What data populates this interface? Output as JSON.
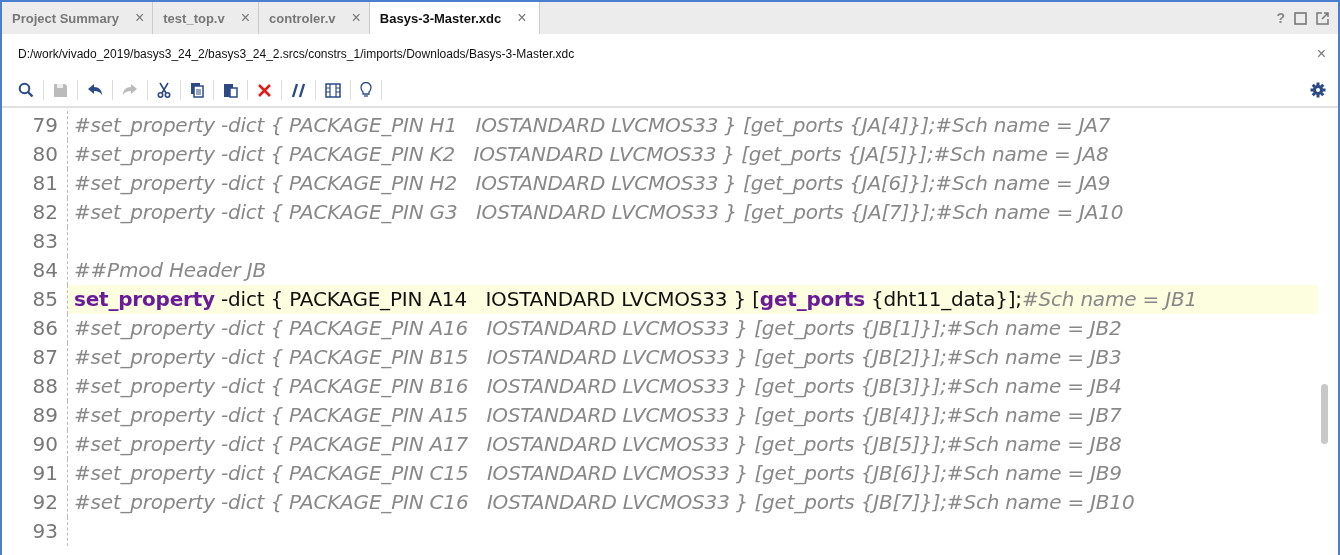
{
  "tabs": [
    {
      "label": "Project Summary",
      "selected": false,
      "close": "×"
    },
    {
      "label": "test_top.v",
      "selected": false,
      "close": "×"
    },
    {
      "label": "controler.v",
      "selected": false,
      "close": "×"
    },
    {
      "label": "Basys-3-Master.xdc",
      "selected": true,
      "close": "×"
    }
  ],
  "tab_bar_actions": [
    {
      "kind": "help",
      "label": "?"
    },
    {
      "kind": "maximize"
    },
    {
      "kind": "float"
    }
  ],
  "file_path": "D:/work/vivado_2019/basys3_24_2/basys3_24_2.srcs/constrs_1/imports/Downloads/Basys-3-Master.xdc",
  "path_close": "×",
  "toolbar": [
    {
      "kind": "search",
      "disabled": false
    },
    {
      "kind": "save",
      "disabled": true
    },
    {
      "kind": "undo",
      "disabled": false
    },
    {
      "kind": "redo",
      "disabled": true
    },
    {
      "kind": "cut",
      "disabled": false
    },
    {
      "kind": "copy",
      "disabled": false
    },
    {
      "kind": "paste",
      "disabled": false
    },
    {
      "kind": "delete",
      "disabled": false
    },
    {
      "kind": "comment",
      "disabled": false
    },
    {
      "kind": "columns",
      "disabled": false
    },
    {
      "kind": "bulb",
      "disabled": false
    }
  ],
  "lines": [
    {
      "number": "79",
      "current": false,
      "segments": [
        {
          "kind": "comment",
          "text": "#set_property -dict { PACKAGE_PIN H1   IOSTANDARD LVCMOS33 } [get_ports {JA[4]}];#Sch name = JA7"
        }
      ]
    },
    {
      "number": "80",
      "current": false,
      "segments": [
        {
          "kind": "comment",
          "text": "#set_property -dict { PACKAGE_PIN K2   IOSTANDARD LVCMOS33 } [get_ports {JA[5]}];#Sch name = JA8"
        }
      ]
    },
    {
      "number": "81",
      "current": false,
      "segments": [
        {
          "kind": "comment",
          "text": "#set_property -dict { PACKAGE_PIN H2   IOSTANDARD LVCMOS33 } [get_ports {JA[6]}];#Sch name = JA9"
        }
      ]
    },
    {
      "number": "82",
      "current": false,
      "segments": [
        {
          "kind": "comment",
          "text": "#set_property -dict { PACKAGE_PIN G3   IOSTANDARD LVCMOS33 } [get_ports {JA[7]}];#Sch name = JA10"
        }
      ]
    },
    {
      "number": "83",
      "current": false
    },
    {
      "number": "84",
      "current": false,
      "segments": [
        {
          "kind": "comment",
          "text": "##Pmod Header JB"
        }
      ]
    },
    {
      "number": "85",
      "current": true,
      "segments": [
        {
          "kind": "keyword",
          "text": "set_property"
        },
        {
          "kind": "plain",
          "text": " -dict { PACKAGE_PIN A14   IOSTANDARD LVCMOS33 } ["
        },
        {
          "kind": "keyword",
          "text": "get_ports"
        },
        {
          "kind": "plain",
          "text": " {dht11_data}];"
        },
        {
          "kind": "comment",
          "text": "#Sch name = JB1"
        }
      ]
    },
    {
      "number": "86",
      "current": false,
      "segments": [
        {
          "kind": "comment",
          "text": "#set_property -dict { PACKAGE_PIN A16   IOSTANDARD LVCMOS33 } [get_ports {JB[1]}];#Sch name = JB2"
        }
      ]
    },
    {
      "number": "87",
      "current": false,
      "segments": [
        {
          "kind": "comment",
          "text": "#set_property -dict { PACKAGE_PIN B15   IOSTANDARD LVCMOS33 } [get_ports {JB[2]}];#Sch name = JB3"
        }
      ]
    },
    {
      "number": "88",
      "current": false,
      "segments": [
        {
          "kind": "comment",
          "text": "#set_property -dict { PACKAGE_PIN B16   IOSTANDARD LVCMOS33 } [get_ports {JB[3]}];#Sch name = JB4"
        }
      ]
    },
    {
      "number": "89",
      "current": false,
      "segments": [
        {
          "kind": "comment",
          "text": "#set_property -dict { PACKAGE_PIN A15   IOSTANDARD LVCMOS33 } [get_ports {JB[4]}];#Sch name = JB7"
        }
      ]
    },
    {
      "number": "90",
      "current": false,
      "segments": [
        {
          "kind": "comment",
          "text": "#set_property -dict { PACKAGE_PIN A17   IOSTANDARD LVCMOS33 } [get_ports {JB[5]}];#Sch name = JB8"
        }
      ]
    },
    {
      "number": "91",
      "current": false,
      "segments": [
        {
          "kind": "comment",
          "text": "#set_property -dict { PACKAGE_PIN C15   IOSTANDARD LVCMOS33 } [get_ports {JB[6]}];#Sch name = JB9"
        }
      ]
    },
    {
      "number": "92",
      "current": false,
      "segments": [
        {
          "kind": "comment",
          "text": "#set_property -dict { PACKAGE_PIN C16   IOSTANDARD LVCMOS33 } [get_ports {JB[7]}];#Sch name = JB10"
        }
      ]
    },
    {
      "number": "93",
      "current": false
    }
  ]
}
